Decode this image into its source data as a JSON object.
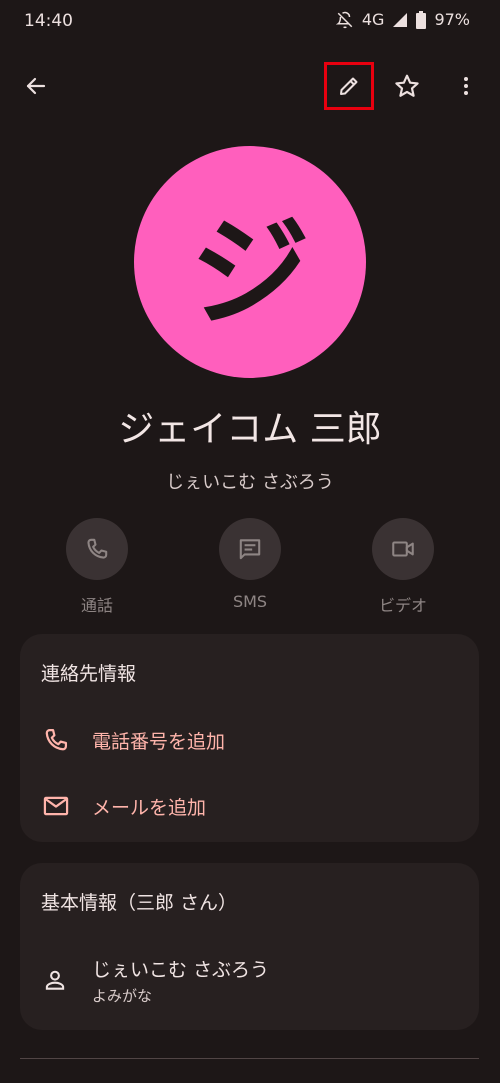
{
  "status": {
    "time": "14:40",
    "network": "4G",
    "battery": "97%"
  },
  "toolbar": {
    "back_icon": "arrow-back-icon",
    "edit_icon": "pencil-icon",
    "star_icon": "star-outline-icon",
    "more_icon": "more-vert-icon"
  },
  "contact": {
    "avatar_letter": "ジ",
    "avatar_color": "#ff5fbd",
    "name": "ジェイコム 三郎",
    "reading": "じぇいこむ さぶろう"
  },
  "actions": [
    {
      "label": "通話",
      "icon": "phone-icon"
    },
    {
      "label": "SMS",
      "icon": "message-icon"
    },
    {
      "label": "ビデオ",
      "icon": "videocam-icon"
    }
  ],
  "contact_info": {
    "title": "連絡先情報",
    "add_phone": "電話番号を追加",
    "add_email": "メールを追加"
  },
  "basic_info": {
    "title": "基本情報（三郎 さん）",
    "reading_value": "じぇいこむ さぶろう",
    "reading_label": "よみがな"
  },
  "colors": {
    "accent": "#ffb4ab",
    "highlight": "#e8000f",
    "background": "#1d1717"
  }
}
